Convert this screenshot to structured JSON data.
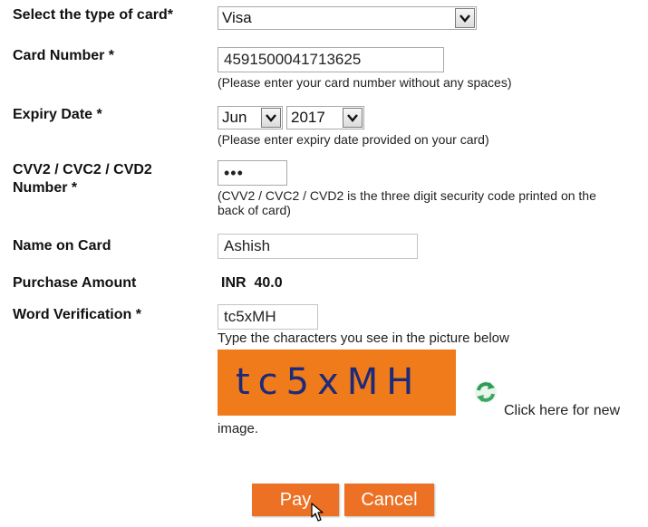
{
  "card_type": {
    "label": "Select the type of card*",
    "value": "Visa"
  },
  "card_number": {
    "label": "Card Number *",
    "value": "4591500041713625",
    "hint": "(Please enter your card number without any spaces)"
  },
  "expiry": {
    "label": "Expiry Date *",
    "month": "Jun",
    "year": "2017",
    "hint": "(Please enter expiry date provided on your card)"
  },
  "cvv": {
    "label_line1": "CVV2 / CVC2 / CVD2",
    "label_line2": "Number *",
    "value": "•••",
    "hint_line1": "(CVV2 / CVC2 / CVD2 is the three digit security code printed on the",
    "hint_line2": "back of card)"
  },
  "name_on_card": {
    "label": "Name on Card",
    "value": "Ashish"
  },
  "purchase_amount": {
    "label": "Purchase Amount",
    "currency": "INR",
    "amount": "40.0"
  },
  "word_verification": {
    "label": "Word Verification *",
    "value": "tc5xMH",
    "instruction": "Type the characters you see in the picture below",
    "captcha_text": "tc5xMH",
    "refresh_link_text": "Click here for new",
    "refresh_link_text_2": "image."
  },
  "buttons": {
    "pay": "Pay",
    "cancel": "Cancel"
  },
  "icons": {
    "dropdown": "chevron-down-icon",
    "refresh": "refresh-icon",
    "cursor": "mouse-pointer-icon"
  },
  "colors": {
    "button_bg": "#ec7124",
    "captcha_bg": "#f07b1a",
    "captcha_text": "#1c2a7a",
    "refresh_icon": "#2e9b57"
  }
}
